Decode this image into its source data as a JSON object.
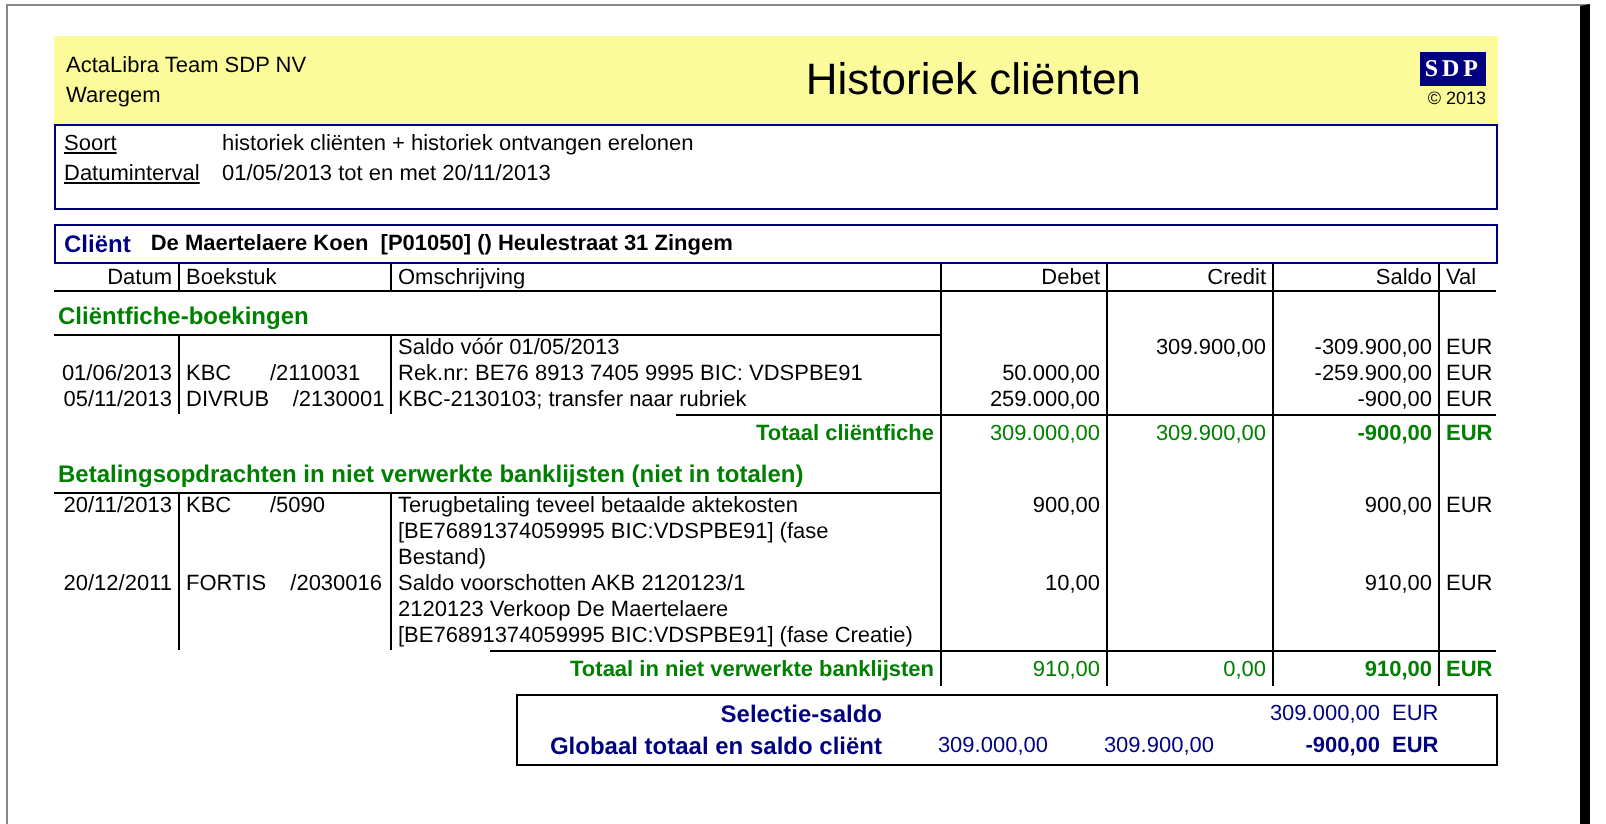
{
  "header": {
    "company": [
      "ActaLibra Team SDP NV",
      "Waregem"
    ],
    "title": "Historiek cliënten",
    "logo": "SDP",
    "copyright": "© 2013"
  },
  "filters": [
    {
      "label": "Soort",
      "value": "historiek cliënten + historiek ontvangen erelonen"
    },
    {
      "label": "Datuminterval",
      "value": "01/05/2013 tot en met 20/11/2013"
    }
  ],
  "client": {
    "label": "Cliënt",
    "value": "De Maertelaere Koen  [P01050] () Heulestraat 31 Zingem"
  },
  "columns": [
    "Datum",
    "Boekstuk",
    "Omschrijving",
    "Debet",
    "Credit",
    "Saldo",
    "Val"
  ],
  "sections": [
    {
      "title": "Cliëntfiche-boekingen",
      "rows": [
        {
          "description": [
            "Saldo vóór 01/05/2013"
          ],
          "credit": "309.900,00",
          "saldo": "-309.900,00",
          "val": "EUR"
        },
        {
          "datum": "01/06/2013",
          "journal": "KBC",
          "number": "/2110031",
          "description": [
            "Rek.nr: BE76 8913 7405 9995 BIC: VDSPBE91"
          ],
          "debet": "50.000,00",
          "saldo": "-259.900,00",
          "val": "EUR"
        },
        {
          "datum": "05/11/2013",
          "journal": "DIVRUB",
          "number": "/2130001",
          "description": [
            "KBC-2130103; transfer naar rubriek"
          ],
          "debet": "259.000,00",
          "saldo": "-900,00",
          "val": "EUR"
        }
      ],
      "total": {
        "label": "Totaal cliëntfiche",
        "debet": "309.000,00",
        "credit": "309.900,00",
        "saldo": "-900,00",
        "val": "EUR"
      }
    },
    {
      "title": "Betalingsopdrachten in niet verwerkte banklijsten (niet in totalen)",
      "rows": [
        {
          "datum": "20/11/2013",
          "journal": "KBC",
          "number": "/5090",
          "description": [
            "Terugbetaling teveel betaalde aktekosten",
            "[BE76891374059995 BIC:VDSPBE91] (fase",
            "Bestand)"
          ],
          "debet": "900,00",
          "saldo": "900,00",
          "val": "EUR"
        },
        {
          "datum": "20/12/2011",
          "journal": "FORTIS",
          "number": "/2030016",
          "description": [
            "Saldo voorschotten AKB 2120123/1",
            "2120123 Verkoop De Maertelaere",
            "[BE76891374059995 BIC:VDSPBE91] (fase Creatie)"
          ],
          "debet": "10,00",
          "saldo": "910,00",
          "val": "EUR"
        }
      ],
      "total": {
        "label": "Totaal in niet verwerkte banklijsten",
        "debet": "910,00",
        "credit": "0,00",
        "saldo": "910,00",
        "val": "EUR"
      }
    }
  ],
  "summary": [
    {
      "label": "Selectie-saldo",
      "saldo": "309.000,00",
      "val": "EUR"
    },
    {
      "label": "Globaal totaal en saldo cliënt",
      "debet": "309.000,00",
      "credit": "309.900,00",
      "saldo": "-900,00",
      "val": "EUR"
    }
  ]
}
